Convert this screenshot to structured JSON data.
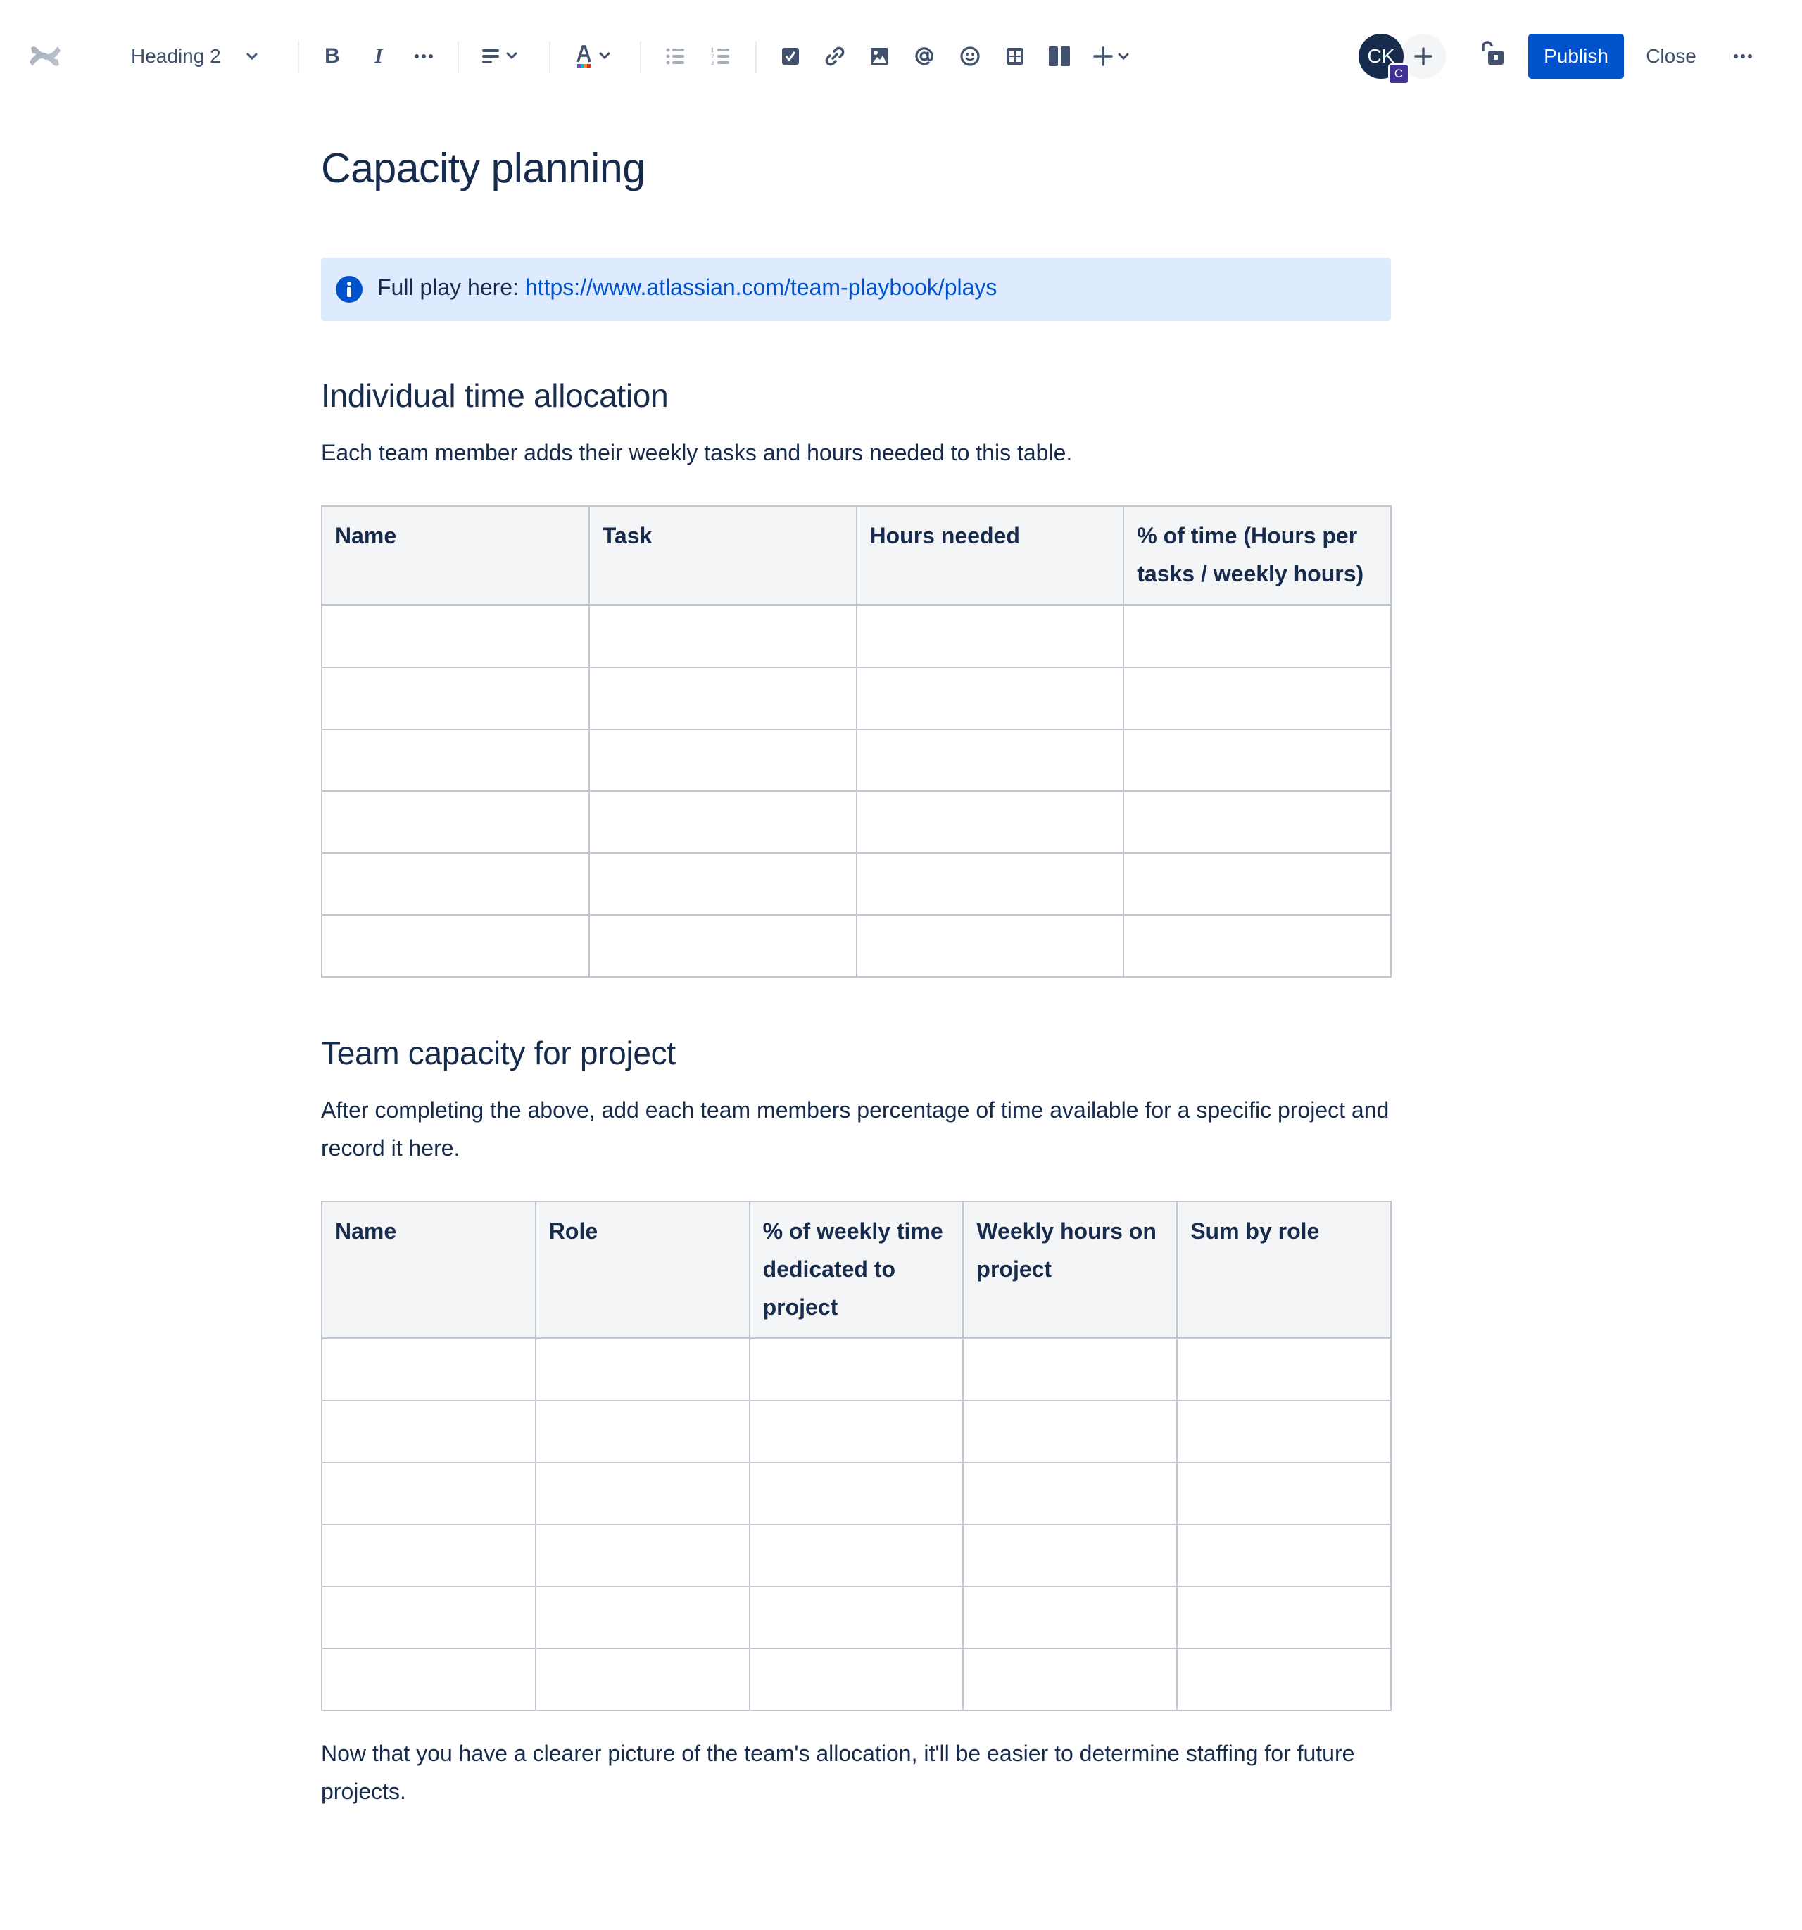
{
  "toolbar": {
    "logo": "confluence-logo",
    "text_style": "Heading 2",
    "buttons": {
      "bold": "B",
      "italic": "I",
      "more_formatting": "more-formatting-icon",
      "alignment": "align-left-icon",
      "text_color": "text-color-icon",
      "bullet_list": "bullet-list-icon",
      "numbered_list": "numbered-list-icon",
      "action_item": "checkbox-icon",
      "link": "link-icon",
      "image": "image-icon",
      "mention": "mention-icon",
      "emoji": "emoji-icon",
      "table": "table-icon",
      "layouts": "layout-icon",
      "insert": "plus-icon"
    },
    "avatar_initials": "CK",
    "avatar_badge": "C",
    "publish_label": "Publish",
    "close_label": "Close"
  },
  "colors": {
    "primary": "#0052CC",
    "text": "#172B4D",
    "info_bg": "#DEEBFF",
    "table_border": "#C1C7D0",
    "table_header_bg": "#F4F5F7",
    "avatar_bg": "#172B4D",
    "badge_bg": "#403294"
  },
  "page": {
    "title": "Capacity planning",
    "info_panel": {
      "prefix": "Full play here: ",
      "link_text": "https://www.atlassian.com/team-playbook/plays"
    },
    "section1": {
      "heading": "Individual time allocation",
      "description": "Each team member adds their weekly tasks and hours needed to this table.",
      "table": {
        "headers": [
          "Name",
          "Task",
          "Hours needed",
          "% of time (Hours per tasks / weekly hours)"
        ],
        "rows": [
          [
            "",
            "",
            "",
            ""
          ],
          [
            "",
            "",
            "",
            ""
          ],
          [
            "",
            "",
            "",
            ""
          ],
          [
            "",
            "",
            "",
            ""
          ],
          [
            "",
            "",
            "",
            ""
          ],
          [
            "",
            "",
            "",
            ""
          ]
        ]
      }
    },
    "section2": {
      "heading": "Team capacity for project",
      "description": "After completing the above, add each team members percentage of time available for a specific project and record it here.",
      "table": {
        "headers": [
          "Name",
          "Role",
          "% of weekly time dedicated to project",
          "Weekly hours on project",
          "Sum by role"
        ],
        "rows": [
          [
            "",
            "",
            "",
            "",
            ""
          ],
          [
            "",
            "",
            "",
            "",
            ""
          ],
          [
            "",
            "",
            "",
            "",
            ""
          ],
          [
            "",
            "",
            "",
            "",
            ""
          ],
          [
            "",
            "",
            "",
            "",
            ""
          ],
          [
            "",
            "",
            "",
            "",
            ""
          ]
        ]
      }
    },
    "closing": "Now that you have a clearer picture of the team's allocation, it'll be easier to determine staffing for future projects."
  }
}
